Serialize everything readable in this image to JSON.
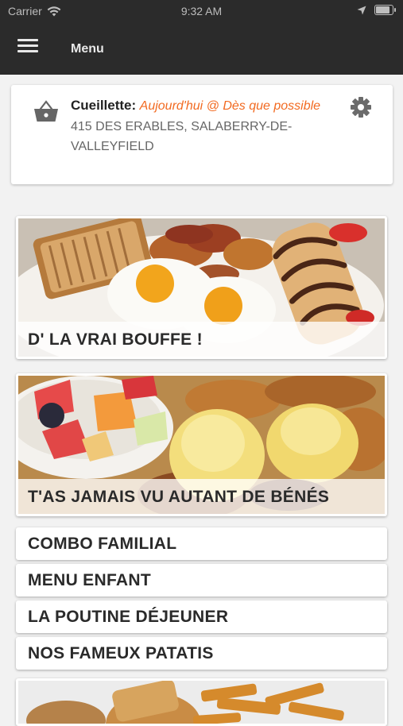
{
  "status_bar": {
    "carrier": "Carrier",
    "time": "9:32 AM",
    "battery_level": 0.9
  },
  "nav": {
    "title": "Menu",
    "menu_icon": "hamburger-icon"
  },
  "pickup": {
    "label": "Cueillette:",
    "when": "Aujourd'hui @ Dès que possible",
    "address": "415 DES ERABLES, SALABERRY-DE-VALLEYFIELD",
    "icon": "basket-icon",
    "settings_icon": "gear-icon",
    "accent_color": "#f26a21"
  },
  "categories": [
    {
      "label": "D' LA VRAI BOUFFE !"
    },
    {
      "label": "T'AS JAMAIS VU AUTANT DE BÉNÉS"
    },
    {
      "label": "COMBO FAMILIAL"
    },
    {
      "label": "MENU ENFANT"
    },
    {
      "label": "LA POUTINE DÉJEUNER"
    },
    {
      "label": "NOS FAMEUX PATATIS"
    }
  ],
  "colors": {
    "header_bg": "#2b2b2b",
    "page_bg": "#f2f2f2"
  }
}
